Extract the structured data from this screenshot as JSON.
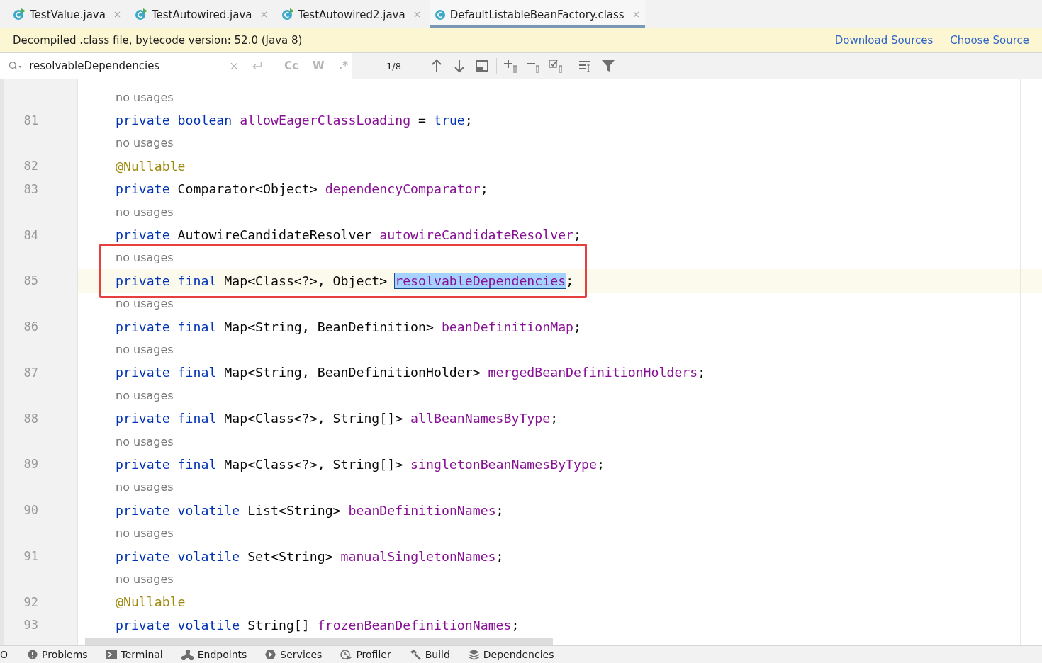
{
  "tabs": [
    {
      "label": "TestValue.java",
      "kind": "runnable",
      "selected": false
    },
    {
      "label": "TestAutowired.java",
      "kind": "runnable",
      "selected": false
    },
    {
      "label": "TestAutowired2.java",
      "kind": "runnable",
      "selected": false
    },
    {
      "label": "DefaultListableBeanFactory.class",
      "kind": "class",
      "selected": true
    }
  ],
  "banner": {
    "message": "Decompiled .class file, bytecode version: 52.0 (Java 8)",
    "links": [
      "Download Sources",
      "Choose Source"
    ]
  },
  "search": {
    "value": "resolvableDependencies",
    "toggles": [
      "Cc",
      "W",
      ".*"
    ],
    "match_count": "1/8"
  },
  "rows": [
    {
      "kind": "hint",
      "text": "no usages"
    },
    {
      "kind": "code",
      "number": "81",
      "tokens": [
        {
          "kind": "kw",
          "text": "private "
        },
        {
          "kind": "kw",
          "text": "boolean "
        },
        {
          "kind": "field",
          "text": "allowEagerClassLoading"
        },
        {
          "kind": "plain",
          "text": " = "
        },
        {
          "kind": "kw",
          "text": "true"
        },
        {
          "kind": "plain",
          "text": ";"
        }
      ]
    },
    {
      "kind": "hint",
      "text": "no usages"
    },
    {
      "kind": "code",
      "number": "82",
      "tokens": [
        {
          "kind": "annot",
          "text": "@Nullable"
        }
      ]
    },
    {
      "kind": "code",
      "number": "83",
      "tokens": [
        {
          "kind": "kw",
          "text": "private "
        },
        {
          "kind": "plain",
          "text": "Comparator<Object> "
        },
        {
          "kind": "field",
          "text": "dependencyComparator"
        },
        {
          "kind": "plain",
          "text": ";"
        }
      ]
    },
    {
      "kind": "hint",
      "text": "no usages"
    },
    {
      "kind": "code",
      "number": "84",
      "tokens": [
        {
          "kind": "kw",
          "text": "private "
        },
        {
          "kind": "plain",
          "text": "AutowireCandidateResolver "
        },
        {
          "kind": "field",
          "text": "autowireCandidateResolver"
        },
        {
          "kind": "plain",
          "text": ";"
        }
      ]
    },
    {
      "kind": "hint",
      "text": "no usages",
      "boxed": true
    },
    {
      "kind": "code",
      "number": "85",
      "current": true,
      "boxed": true,
      "tokens": [
        {
          "kind": "kw",
          "text": "private "
        },
        {
          "kind": "kw",
          "text": "final "
        },
        {
          "kind": "plain",
          "text": "Map<Class<?>, Object> "
        },
        {
          "kind": "field",
          "text": "resolvableDependencies",
          "match": true
        },
        {
          "kind": "plain",
          "text": ";"
        }
      ]
    },
    {
      "kind": "hint",
      "text": "no usages"
    },
    {
      "kind": "code",
      "number": "86",
      "tokens": [
        {
          "kind": "kw",
          "text": "private "
        },
        {
          "kind": "kw",
          "text": "final "
        },
        {
          "kind": "plain",
          "text": "Map<String, BeanDefinition> "
        },
        {
          "kind": "field",
          "text": "beanDefinitionMap"
        },
        {
          "kind": "plain",
          "text": ";"
        }
      ]
    },
    {
      "kind": "hint",
      "text": "no usages"
    },
    {
      "kind": "code",
      "number": "87",
      "tokens": [
        {
          "kind": "kw",
          "text": "private "
        },
        {
          "kind": "kw",
          "text": "final "
        },
        {
          "kind": "plain",
          "text": "Map<String, BeanDefinitionHolder> "
        },
        {
          "kind": "field",
          "text": "mergedBeanDefinitionHolders"
        },
        {
          "kind": "plain",
          "text": ";"
        }
      ]
    },
    {
      "kind": "hint",
      "text": "no usages"
    },
    {
      "kind": "code",
      "number": "88",
      "tokens": [
        {
          "kind": "kw",
          "text": "private "
        },
        {
          "kind": "kw",
          "text": "final "
        },
        {
          "kind": "plain",
          "text": "Map<Class<?>, String[]> "
        },
        {
          "kind": "field",
          "text": "allBeanNamesByType"
        },
        {
          "kind": "plain",
          "text": ";"
        }
      ]
    },
    {
      "kind": "hint",
      "text": "no usages"
    },
    {
      "kind": "code",
      "number": "89",
      "tokens": [
        {
          "kind": "kw",
          "text": "private "
        },
        {
          "kind": "kw",
          "text": "final "
        },
        {
          "kind": "plain",
          "text": "Map<Class<?>, String[]> "
        },
        {
          "kind": "field",
          "text": "singletonBeanNamesByType"
        },
        {
          "kind": "plain",
          "text": ";"
        }
      ]
    },
    {
      "kind": "hint",
      "text": "no usages"
    },
    {
      "kind": "code",
      "number": "90",
      "tokens": [
        {
          "kind": "kw",
          "text": "private "
        },
        {
          "kind": "kw",
          "text": "volatile "
        },
        {
          "kind": "plain",
          "text": "List<String> "
        },
        {
          "kind": "field",
          "text": "beanDefinitionNames"
        },
        {
          "kind": "plain",
          "text": ";"
        }
      ]
    },
    {
      "kind": "hint",
      "text": "no usages"
    },
    {
      "kind": "code",
      "number": "91",
      "tokens": [
        {
          "kind": "kw",
          "text": "private "
        },
        {
          "kind": "kw",
          "text": "volatile "
        },
        {
          "kind": "plain",
          "text": "Set<String> "
        },
        {
          "kind": "field",
          "text": "manualSingletonNames"
        },
        {
          "kind": "plain",
          "text": ";"
        }
      ]
    },
    {
      "kind": "hint",
      "text": "no usages"
    },
    {
      "kind": "code",
      "number": "92",
      "tokens": [
        {
          "kind": "annot",
          "text": "@Nullable"
        }
      ]
    },
    {
      "kind": "code",
      "number": "93",
      "tokens": [
        {
          "kind": "kw",
          "text": "private "
        },
        {
          "kind": "kw",
          "text": "volatile "
        },
        {
          "kind": "plain",
          "text": "String[] "
        },
        {
          "kind": "field",
          "text": "frozenBeanDefinitionNames"
        },
        {
          "kind": "plain",
          "text": ";"
        }
      ]
    }
  ],
  "tool_windows": [
    {
      "label": "O",
      "kind": "none"
    },
    {
      "label": "Problems",
      "kind": "problems"
    },
    {
      "label": "Terminal",
      "kind": "terminal"
    },
    {
      "label": "Endpoints",
      "kind": "endpoints"
    },
    {
      "label": "Services",
      "kind": "services"
    },
    {
      "label": "Profiler",
      "kind": "profiler"
    },
    {
      "label": "Build",
      "kind": "build"
    },
    {
      "label": "Dependencies",
      "kind": "dependencies"
    }
  ]
}
